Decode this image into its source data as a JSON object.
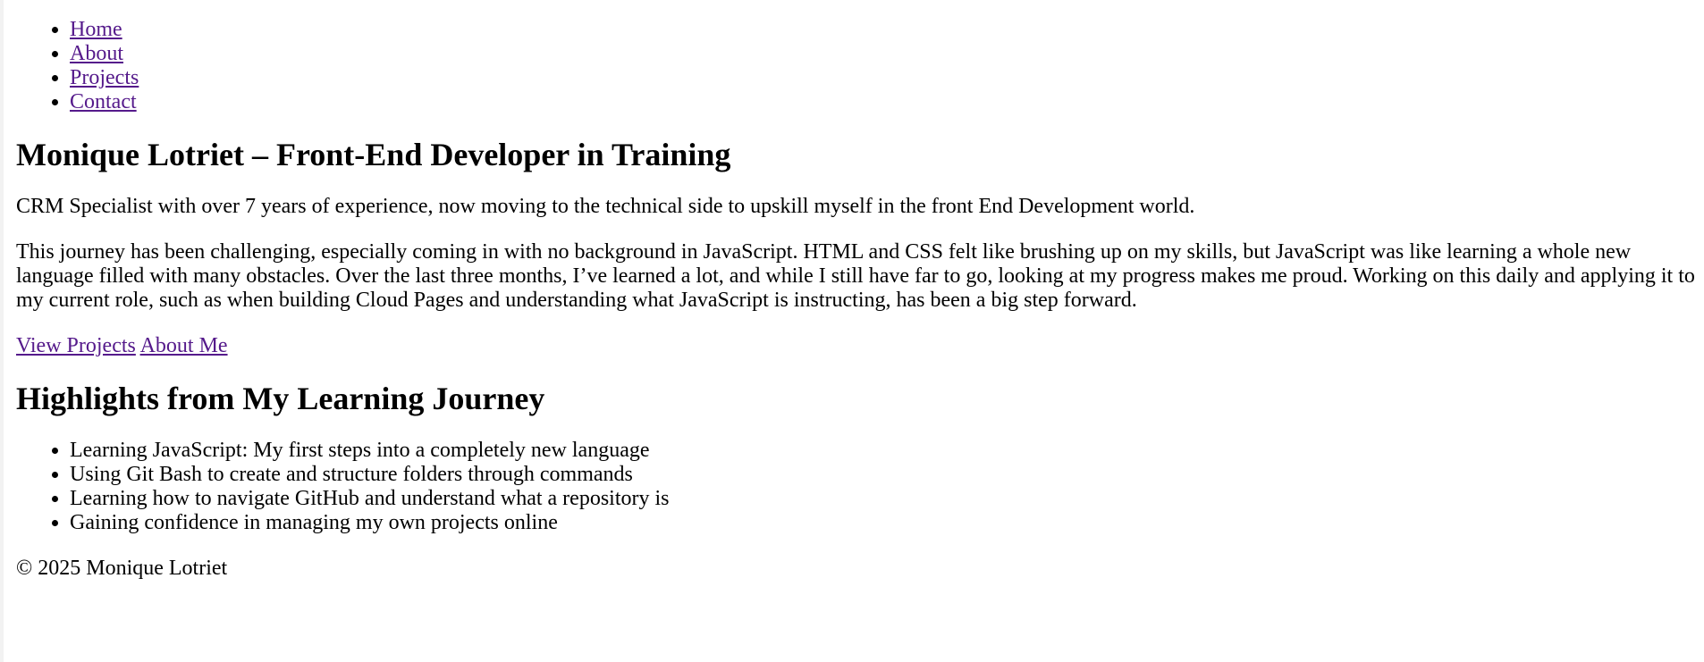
{
  "nav": {
    "items": [
      {
        "label": "Home"
      },
      {
        "label": "About"
      },
      {
        "label": "Projects"
      },
      {
        "label": "Contact"
      }
    ]
  },
  "hero": {
    "title": "Monique Lotriet – Front-End Developer in Training",
    "paragraph_1": "CRM Specialist with over 7 years of experience, now moving to the technical side to upskill myself in the front End Development world.",
    "paragraph_2": "This journey has been challenging, especially coming in with no background in JavaScript. HTML and CSS felt like brushing up on my skills, but JavaScript was like learning a whole new language filled with many obstacles. Over the last three months, I’ve learned a lot, and while I still have far to go, looking at my progress makes me proud. Working on this daily and applying it to my current role, such as when building Cloud Pages and understanding what JavaScript is instructing, has been a big step forward.",
    "cta": {
      "projects_label": "View Projects",
      "about_label": "About Me"
    }
  },
  "highlights": {
    "title": "Highlights from My Learning Journey",
    "items": [
      "Learning JavaScript: My first steps into a completely new language",
      "Using Git Bash to create and structure folders through commands",
      "Learning how to navigate GitHub and understand what a repository is",
      "Gaining confidence in managing my own projects online"
    ]
  },
  "footer": {
    "text": "© 2025 Monique Lotriet"
  },
  "colors": {
    "link": "#551a8b",
    "text": "#000000",
    "background": "#ffffff"
  }
}
